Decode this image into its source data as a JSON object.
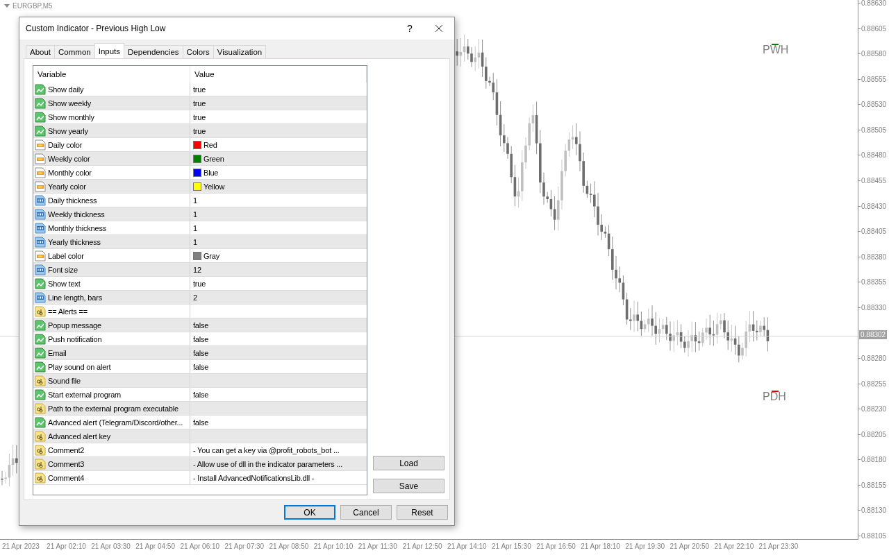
{
  "chart": {
    "symbol": "EURGBP,M5",
    "labels": [
      {
        "text": "PWH",
        "color": "#008000"
      },
      {
        "text": "PDH",
        "color": "#dd0000"
      }
    ],
    "price_ticks_upper": [
      "0.88630",
      "0.88605",
      "0.88580",
      "0.88555",
      "0.88530",
      "0.88505",
      "0.88480",
      "0.88455",
      "0.88430",
      "0.88405",
      "0.88380",
      "0.88355",
      "0.88330"
    ],
    "price_ticks_lower": [
      "0.88280",
      "0.88255",
      "0.88230",
      "0.88205",
      "0.88180",
      "0.88155",
      "0.88130",
      "0.88105"
    ],
    "current_price": "0.88302",
    "time_ticks": [
      "21 Apr 2023",
      "21 Apr 02:10",
      "21 Apr 03:30",
      "21 Apr 04:50",
      "21 Apr 06:10",
      "21 Apr 07:30",
      "21 Apr 08:50",
      "21 Apr 10:10",
      "21 Apr 11:30",
      "21 Apr 12:50",
      "21 Apr 14:10",
      "21 Apr 15:30",
      "21 Apr 16:50",
      "21 Apr 18:10",
      "21 Apr 19:30",
      "21 Apr 20:50",
      "21 Apr 22:10",
      "21 Apr 23:30"
    ]
  },
  "dialog": {
    "title": "Custom Indicator - Previous High Low",
    "help": "?",
    "tabs": [
      {
        "label": "About",
        "selected": false
      },
      {
        "label": "Common",
        "selected": false
      },
      {
        "label": "Inputs",
        "selected": true
      },
      {
        "label": "Dependencies",
        "selected": false
      },
      {
        "label": "Colors",
        "selected": false
      },
      {
        "label": "Visualization",
        "selected": false
      }
    ],
    "table": {
      "columns": [
        "Variable",
        "Value"
      ],
      "rows": [
        {
          "kind": "bool",
          "name": "Show daily",
          "value": "true"
        },
        {
          "kind": "bool",
          "name": "Show weekly",
          "value": "true"
        },
        {
          "kind": "bool",
          "name": "Show monthly",
          "value": "true"
        },
        {
          "kind": "bool",
          "name": "Show yearly",
          "value": "true"
        },
        {
          "kind": "color",
          "name": "Daily color",
          "value": "Red",
          "color": "#ff0000"
        },
        {
          "kind": "color",
          "name": "Weekly color",
          "value": "Green",
          "color": "#008000"
        },
        {
          "kind": "color",
          "name": "Monthly color",
          "value": "Blue",
          "color": "#0000ff"
        },
        {
          "kind": "color",
          "name": "Yearly color",
          "value": "Yellow",
          "color": "#ffff00"
        },
        {
          "kind": "number",
          "name": "Daily thickness",
          "value": "1"
        },
        {
          "kind": "number",
          "name": "Weekly thickness",
          "value": "1"
        },
        {
          "kind": "number",
          "name": "Monthly thickness",
          "value": "1"
        },
        {
          "kind": "number",
          "name": "Yearly thickness",
          "value": "1"
        },
        {
          "kind": "color",
          "name": "Label color",
          "value": "Gray",
          "color": "#808080"
        },
        {
          "kind": "number",
          "name": "Font size",
          "value": "12"
        },
        {
          "kind": "bool",
          "name": "Show text",
          "value": "true"
        },
        {
          "kind": "number",
          "name": "Line length, bars",
          "value": "2"
        },
        {
          "kind": "string",
          "name": "== Alerts =="
        },
        {
          "kind": "bool",
          "name": "Popup message",
          "value": "false"
        },
        {
          "kind": "bool",
          "name": "Push notification",
          "value": "false"
        },
        {
          "kind": "bool",
          "name": "Email",
          "value": "false"
        },
        {
          "kind": "bool",
          "name": "Play sound on alert",
          "value": "false"
        },
        {
          "kind": "string",
          "name": "Sound file"
        },
        {
          "kind": "bool",
          "name": "Start external program",
          "value": "false"
        },
        {
          "kind": "string",
          "name": "Path to the external program executable"
        },
        {
          "kind": "bool",
          "name": "Advanced alert (Telegram/Discord/other...",
          "value": "false"
        },
        {
          "kind": "string",
          "name": "Advanced alert key"
        },
        {
          "kind": "string",
          "name": "Comment2",
          "value": "- You can get a key via @profit_robots_bot ..."
        },
        {
          "kind": "string",
          "name": "Comment3",
          "value": "- Allow use of dll in the indicator parameters ..."
        },
        {
          "kind": "string",
          "name": "Comment4",
          "value": "- Install AdvancedNotificationsLib.dll -"
        }
      ]
    },
    "side_buttons": [
      "Load",
      "Save"
    ],
    "buttons": [
      {
        "label": "OK",
        "default": true
      },
      {
        "label": "Cancel",
        "default": false
      },
      {
        "label": "Reset",
        "default": false
      }
    ]
  }
}
